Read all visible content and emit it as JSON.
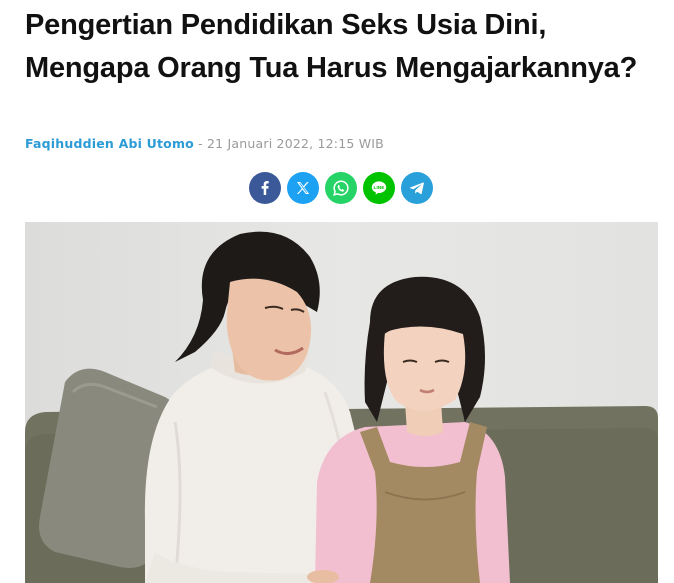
{
  "article": {
    "title": "Pengertian Pendidikan Seks Usia Dini, Mengapa Orang Tua Harus Mengajarkannya?",
    "author": "Faqihuddien Abi Utomo",
    "separator": " - ",
    "date": "21 Januari 2022, 12:15 WIB"
  },
  "share": {
    "buttons": [
      {
        "network": "facebook",
        "icon": "facebook-icon",
        "color": "#3b5998"
      },
      {
        "network": "x",
        "icon": "x-icon",
        "color": "#1da1f2"
      },
      {
        "network": "whatsapp",
        "icon": "whatsapp-icon",
        "color": "#25d366"
      },
      {
        "network": "line",
        "icon": "line-icon",
        "color": "#00c300"
      },
      {
        "network": "telegram",
        "icon": "telegram-icon",
        "color": "#2aa0da"
      }
    ]
  },
  "hero_image": {
    "subject": "mother-and-daughter-on-sofa",
    "colors": {
      "wall": "#e4e4e2",
      "sofa": "#71725f",
      "sweater": "#f1eee9",
      "dress": "#a48a62",
      "shirt": "#f2bfd0",
      "hair": "#1d1a18",
      "skin": "#ecc3a8"
    }
  }
}
